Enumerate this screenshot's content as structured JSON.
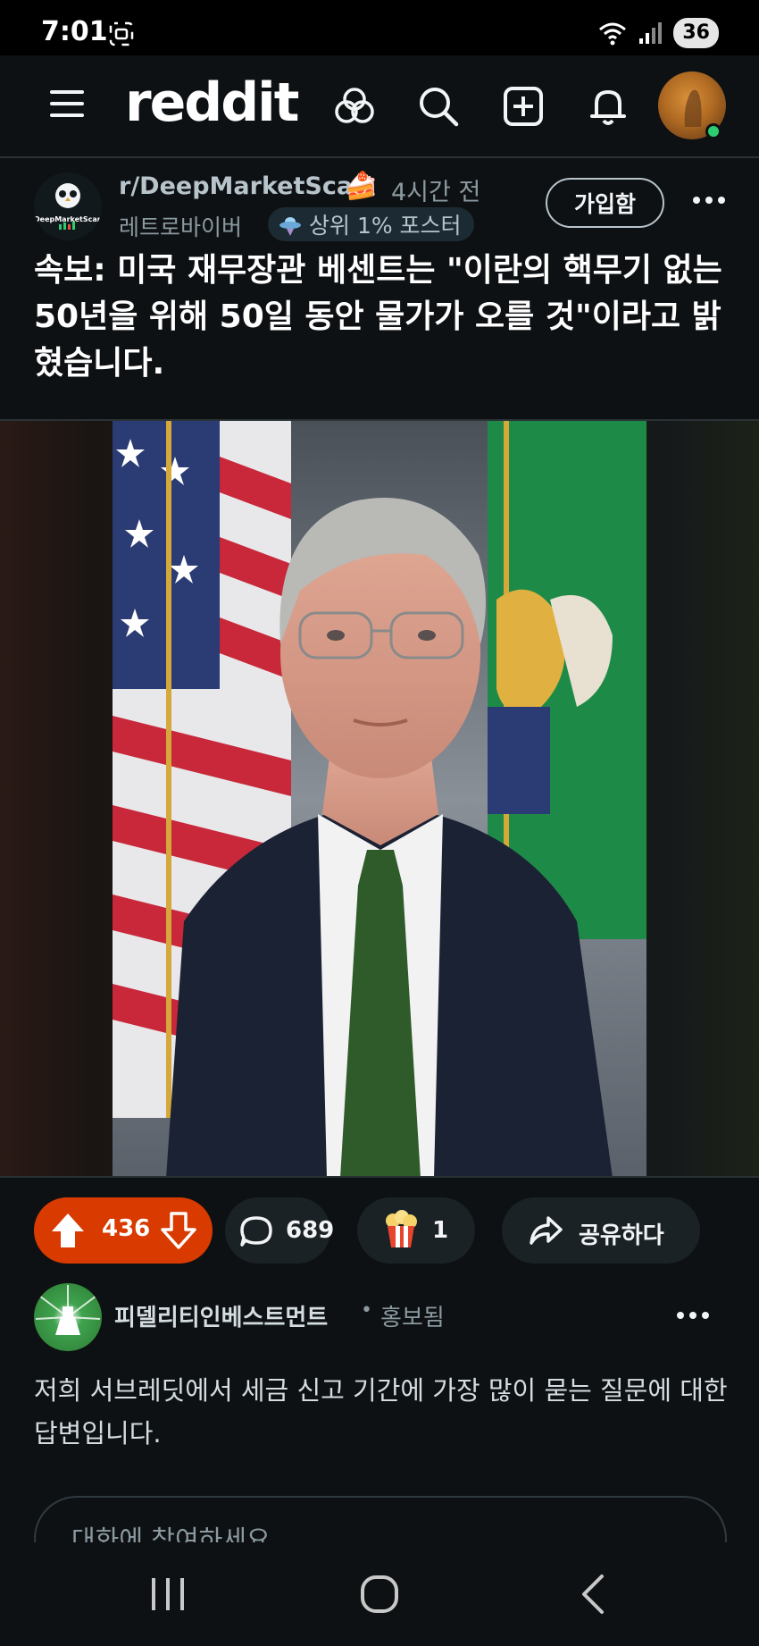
{
  "status_bar": {
    "time": "7:01",
    "battery": "36"
  },
  "header": {
    "logo": "reddit",
    "icons": [
      "menu-icon",
      "popular-icon",
      "search-icon",
      "create-icon",
      "notification-icon",
      "avatar"
    ]
  },
  "post": {
    "subreddit": "r/DeepMarketScan",
    "subreddit_icon_text": "DeepMarketScan",
    "time_ago": "4시간 전",
    "user_flair": "레트로바이버",
    "badge": "상위 1% 포스터",
    "join_label": "가입함",
    "title": "속보: 미국 재무장관 베센트는 \"이란의 핵무기 없는 50년을 위해 50일 동안 물가가 오를 것\"이라고 밝혔습니다.",
    "image_alt": "portrait photo",
    "upvotes": "436",
    "comments": "689",
    "awards": "1",
    "share_label": "공유하다"
  },
  "promoted": {
    "advertiser": "피델리티인베스트먼트",
    "separator": "•",
    "label": "홍보됨",
    "text": "저희 서브레딧에서 세금 신고 기간에 가장 많이 묻는 질문에 대한 답변입니다.",
    "comment_placeholder": "대화에 참여하세요"
  },
  "colors": {
    "background": "#0e1113",
    "upvote_active": "#d93a00",
    "pill": "#1a2226",
    "text": "#f2f4f5",
    "muted": "#8b9aa1"
  }
}
